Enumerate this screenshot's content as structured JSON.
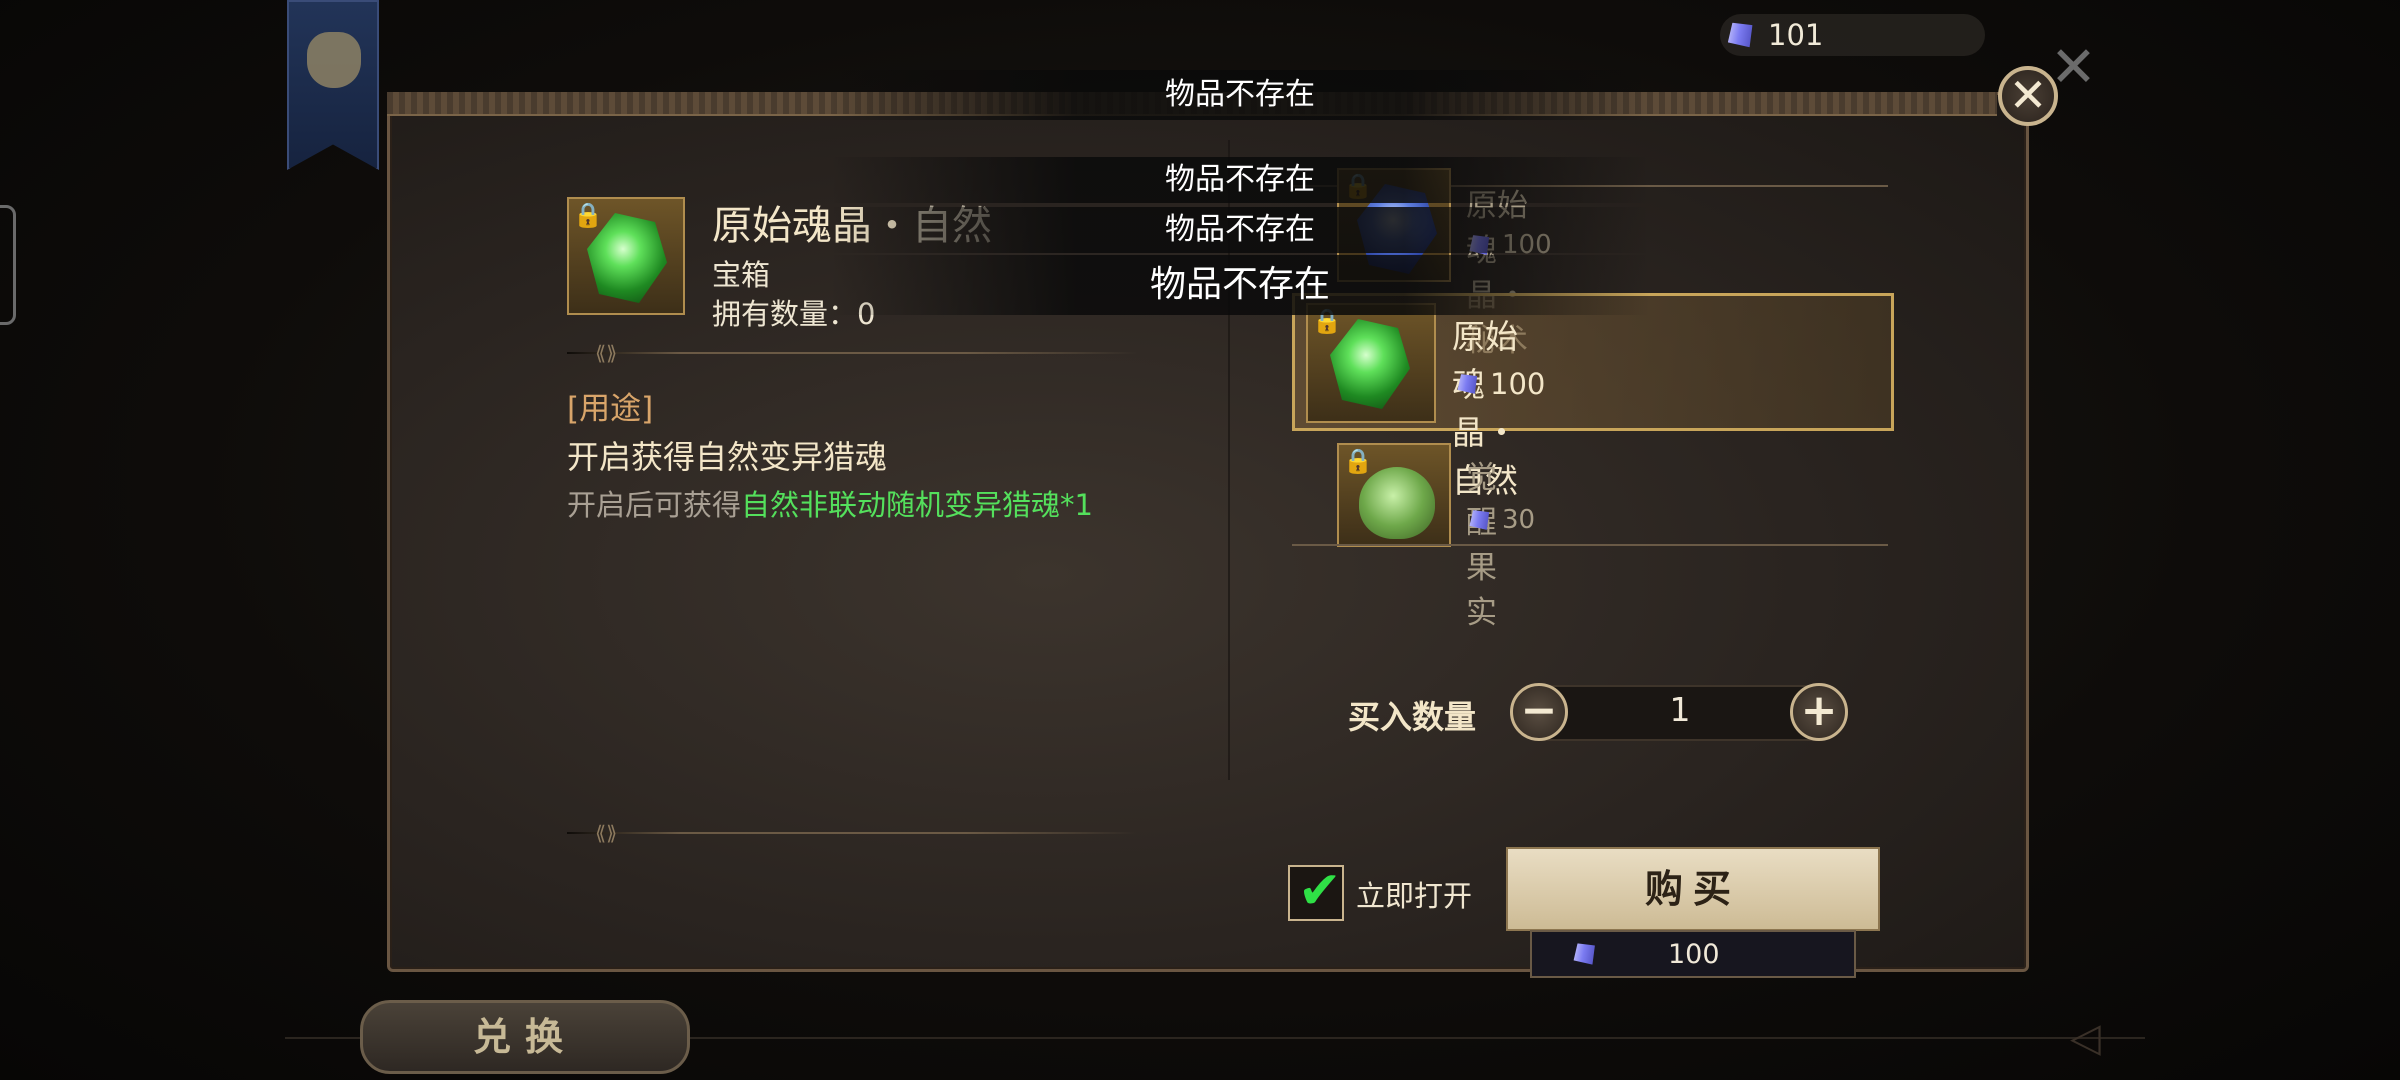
{
  "currency": {
    "amount": "101"
  },
  "toasts": [
    "物品不存在",
    "物品不存在",
    "物品不存在",
    "物品不存在"
  ],
  "detail": {
    "name_main": "原始魂晶・",
    "name_suffix": "自然",
    "type": "宝箱",
    "owned_label": "拥有数量：",
    "owned_value": "0",
    "usage_tag": "[用途]",
    "usage_title": "开启获得自然变异猎魂",
    "usage_desc_prefix": "开启后可获得",
    "usage_desc_highlight": "自然非联动随机变异猎魂*1"
  },
  "shop_list": [
    {
      "name": "原始魂晶・秘术",
      "price": "100",
      "icon": "blue-crystal-icon",
      "locked": true
    },
    {
      "name": "原始魂晶・自然",
      "price": "100",
      "icon": "green-crystal-icon",
      "locked": true,
      "selected": true
    },
    {
      "name": "觉醒果实",
      "price": "30",
      "icon": "fruit-icon",
      "locked": true
    }
  ],
  "quantity": {
    "label": "买入数量",
    "value": "1",
    "minus": "−",
    "plus": "+"
  },
  "purchase": {
    "open_now_label": "立即打开",
    "open_now_checked": true,
    "buy_label": "购买",
    "total_price": "100"
  },
  "tabs": {
    "exchange": "兑换"
  },
  "colors": {
    "accent_gold": "#c8a55a",
    "highlight_green": "#54e05c",
    "usage_orange": "#d9a56a"
  }
}
